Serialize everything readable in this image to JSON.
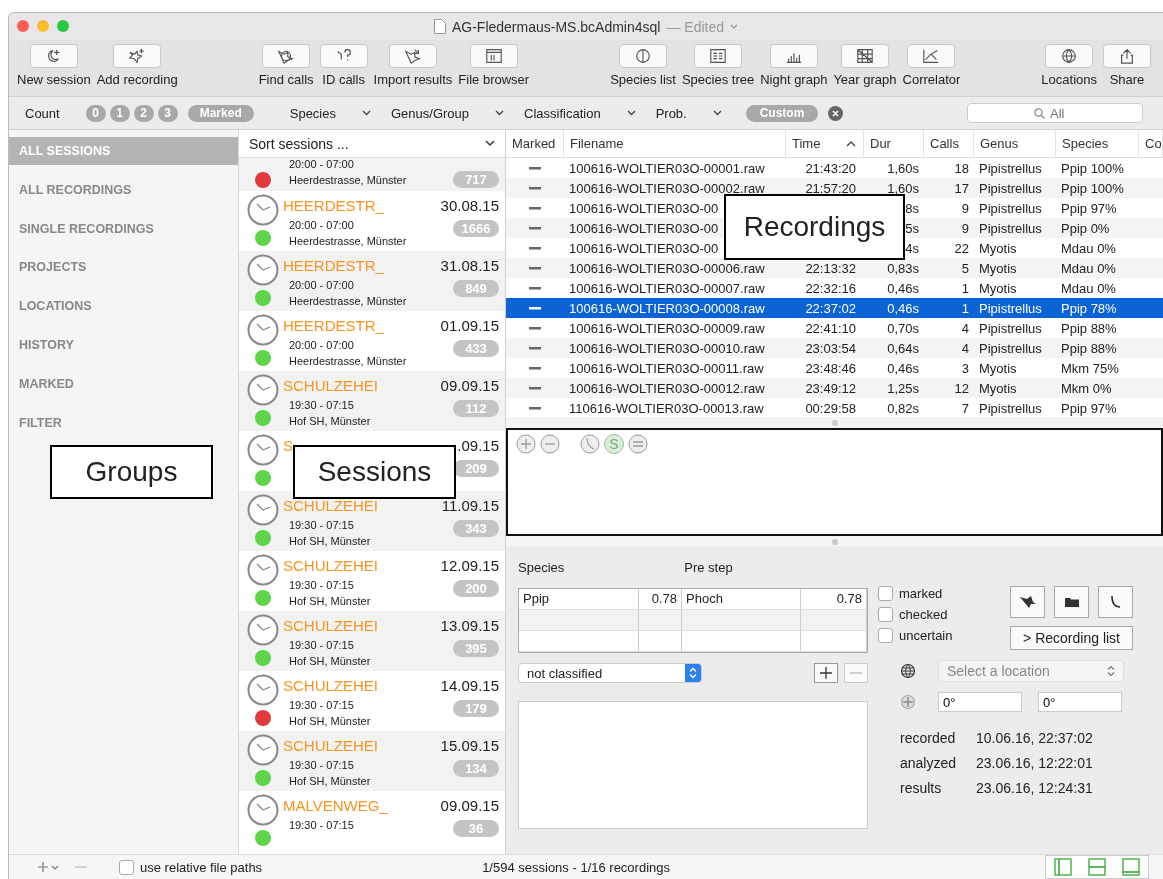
{
  "window": {
    "title": "AG-Fledermaus-MS.bcAdmin4sql",
    "status": "— Edited"
  },
  "toolbar": {
    "groups": [
      [
        {
          "label": "New session"
        },
        {
          "label": "Add recording"
        }
      ],
      [
        {
          "label": "Find calls"
        },
        {
          "label": "ID calls"
        },
        {
          "label": "Import results"
        },
        {
          "label": "File browser"
        }
      ],
      [
        {
          "label": "Species list"
        },
        {
          "label": "Species tree"
        },
        {
          "label": "Night graph"
        },
        {
          "label": "Year graph"
        },
        {
          "label": "Correlator"
        }
      ],
      [
        {
          "label": "Locations"
        },
        {
          "label": "Share"
        }
      ]
    ]
  },
  "filter_bar": {
    "count_label": "Count",
    "count_chips": [
      "0",
      "1",
      "2",
      "3"
    ],
    "marked_chip": "Marked",
    "dropdowns": [
      "Species",
      "Genus/Group",
      "Classification",
      "Prob."
    ],
    "custom": "Custom",
    "search": {
      "placeholder": "All"
    }
  },
  "sidebar": {
    "items": [
      {
        "label": "ALL SESSIONS",
        "selected": true
      },
      {
        "label": "ALL RECORDINGS",
        "selected": false
      },
      {
        "label": "SINGLE RECORDINGS",
        "selected": false
      },
      {
        "label": "PROJECTS",
        "selected": false
      },
      {
        "label": "LOCATIONS",
        "selected": false
      },
      {
        "label": "HISTORY",
        "selected": false
      },
      {
        "label": "MARKED",
        "selected": false
      },
      {
        "label": "FILTER",
        "selected": false
      }
    ]
  },
  "sessions": {
    "sort_label": "Sort sessions ...",
    "items": [
      {
        "time": "20:00 - 07:00",
        "location": "Heerdestrasse, Münster",
        "count": "717",
        "color": "#e0393e"
      },
      {
        "name": "HEERDESTR_",
        "date": "30.08.15",
        "time": "20:00 - 07:00",
        "location": "Heerdestrasse, Münster",
        "count": "1666",
        "color": "#5fd34a"
      },
      {
        "name": "HEERDESTR_",
        "date": "31.08.15",
        "time": "20:00 - 07:00",
        "location": "Heerdestrasse, Münster",
        "count": "849",
        "color": "#5fd34a"
      },
      {
        "name": "HEERDESTR_",
        "date": "01.09.15",
        "time": "20:00 - 07:00",
        "location": "Heerdestrasse, Münster",
        "count": "433",
        "color": "#5fd34a"
      },
      {
        "name": "SCHULZEHEI",
        "date": "09.09.15",
        "time": "19:30 - 07:15",
        "location": "Hof SH, Münster",
        "count": "112",
        "color": "#5fd34a"
      },
      {
        "name": "S",
        "date": ".09.15",
        "count": "209",
        "color": "#5fd34a"
      },
      {
        "name": "SCHULZEHEI",
        "date": "11.09.15",
        "time": "19:30 - 07:15",
        "location": "Hof SH, Münster",
        "count": "343",
        "color": "#5fd34a"
      },
      {
        "name": "SCHULZEHEI",
        "date": "12.09.15",
        "time": "19:30 - 07:15",
        "location": "Hof SH, Münster",
        "count": "200",
        "color": "#5fd34a"
      },
      {
        "name": "SCHULZEHEI",
        "date": "13.09.15",
        "time": "19:30 - 07:15",
        "location": "Hof SH, Münster",
        "count": "395",
        "color": "#5fd34a"
      },
      {
        "name": "SCHULZEHEI",
        "date": "14.09.15",
        "time": "19:30 - 07:15",
        "location": "Hof SH, Münster",
        "count": "179",
        "color": "#e0393e"
      },
      {
        "name": "SCHULZEHEI",
        "date": "15.09.15",
        "time": "19:30 - 07:15",
        "location": "Hof SH, Münster",
        "count": "134",
        "color": "#5fd34a"
      },
      {
        "name": "MALVENWEG_",
        "date": "09.09.15",
        "time": "19:30 - 07:15",
        "count": "36",
        "color": "#5fd34a"
      }
    ]
  },
  "recordings": {
    "columns": [
      {
        "label": "Marked"
      },
      {
        "label": "Filename"
      },
      {
        "label": "Time",
        "sort_ascending": true
      },
      {
        "label": "Dur"
      },
      {
        "label": "Calls"
      },
      {
        "label": "Genus"
      },
      {
        "label": "Species"
      },
      {
        "label": "Co"
      }
    ],
    "rows": [
      {
        "marked": false,
        "selected": false,
        "filename": "100616-WOLTIER03O-00001.raw",
        "time": "21:43:20",
        "dur": "1,60s",
        "calls": "18",
        "genus": "Pipistrellus",
        "species": "Ppip 100%"
      },
      {
        "marked": false,
        "selected": false,
        "filename": "100616-WOLTIER03O-00002.raw",
        "time": "21:57:20",
        "dur": "1,60s",
        "calls": "17",
        "genus": "Pipistrellus",
        "species": "Ppip 100%"
      },
      {
        "marked": false,
        "selected": false,
        "filename": "100616-WOLTIER03O-00",
        "dur": "8s",
        "calls": "9",
        "genus": "Pipistrellus",
        "species": "Ppip 97%"
      },
      {
        "marked": false,
        "selected": false,
        "filename": "100616-WOLTIER03O-00",
        "dur": "5s",
        "calls": "9",
        "genus": "Pipistrellus",
        "species": "Ppip 0%"
      },
      {
        "marked": false,
        "selected": false,
        "filename": "100616-WOLTIER03O-00",
        "dur": "4s",
        "calls": "22",
        "genus": "Myotis",
        "species": "Mdau 0%"
      },
      {
        "marked": false,
        "selected": false,
        "filename": "100616-WOLTIER03O-00006.raw",
        "time": "22:13:32",
        "dur": "0,83s",
        "calls": "5",
        "genus": "Myotis",
        "species": "Mdau 0%"
      },
      {
        "marked": false,
        "selected": false,
        "filename": "100616-WOLTIER03O-00007.raw",
        "time": "22:32:16",
        "dur": "0,46s",
        "calls": "1",
        "genus": "Myotis",
        "species": "Mdau 0%"
      },
      {
        "marked": false,
        "selected": true,
        "filename": "100616-WOLTIER03O-00008.raw",
        "time": "22:37:02",
        "dur": "0,46s",
        "calls": "1",
        "genus": "Pipistrellus",
        "species": "Ppip 78%"
      },
      {
        "marked": false,
        "selected": false,
        "filename": "100616-WOLTIER03O-00009.raw",
        "time": "22:41:10",
        "dur": "0,70s",
        "calls": "4",
        "genus": "Pipistrellus",
        "species": "Ppip 88%"
      },
      {
        "marked": false,
        "selected": false,
        "filename": "100616-WOLTIER03O-00010.raw",
        "time": "23:03:54",
        "dur": "0,64s",
        "calls": "4",
        "genus": "Pipistrellus",
        "species": "Ppip 88%"
      },
      {
        "marked": false,
        "selected": false,
        "filename": "100616-WOLTIER03O-00011.raw",
        "time": "23:48:46",
        "dur": "0,46s",
        "calls": "3",
        "genus": "Myotis",
        "species": "Mkm 75%"
      },
      {
        "marked": false,
        "selected": false,
        "filename": "100616-WOLTIER03O-00012.raw",
        "time": "23:49:12",
        "dur": "1,25s",
        "calls": "12",
        "genus": "Myotis",
        "species": "Mkm 0%"
      },
      {
        "marked": false,
        "selected": false,
        "filename": "110616-WOLTIER03O-00013.raw",
        "time": "00:29:58",
        "dur": "0,82s",
        "calls": "7",
        "genus": "Pipistrellus",
        "species": "Ppip 97%"
      }
    ]
  },
  "waveform": {
    "s_tool": "S"
  },
  "details": {
    "species_header": "Species",
    "pre_step_header": "Pre step",
    "species_rows": [
      {
        "species": "Ppip",
        "score": "0.78",
        "pre_step": "Phoch",
        "pre_score": "0.78"
      }
    ],
    "classification": "not classified",
    "flags": [
      {
        "label": "marked",
        "checked": false
      },
      {
        "label": "checked",
        "checked": false
      },
      {
        "label": "uncertain",
        "checked": false
      }
    ],
    "recording_list_button": "> Recording list",
    "location": {
      "placeholder": "Select a location"
    },
    "latitude": "0°",
    "longitude": "0°",
    "info": [
      {
        "label": "recorded",
        "value": "10.06.16, 22:37:02"
      },
      {
        "label": "analyzed",
        "value": "23.06.16, 12:22:01"
      },
      {
        "label": "results",
        "value": "23.06.16, 12:24:31"
      }
    ]
  },
  "status_bar": {
    "relative_paths": {
      "label": "use relative file paths",
      "checked": false
    },
    "summary": "1/594 sessions - 1/16 recordings"
  },
  "callouts": [
    "Groups",
    "Sessions",
    "Recordings"
  ]
}
